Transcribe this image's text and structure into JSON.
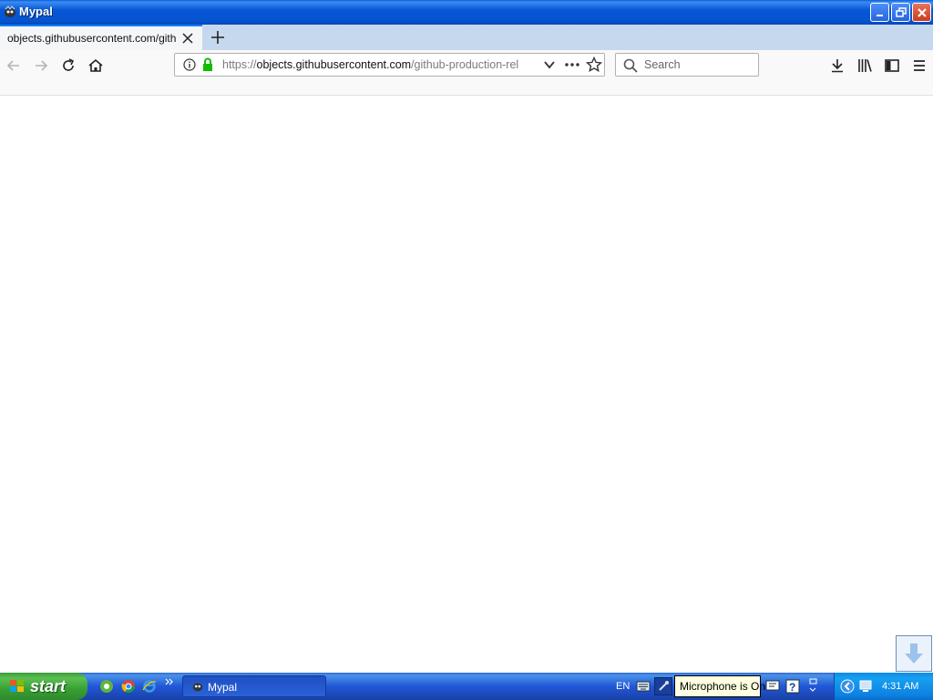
{
  "window": {
    "title": "Mypal",
    "icon": "mypal-app-icon"
  },
  "window_controls": {
    "minimize_icon": "minimize-icon",
    "restore_icon": "restore-icon",
    "close_icon": "close-icon"
  },
  "tabs": [
    {
      "label": "objects.githubusercontent.com/github",
      "active": true
    }
  ],
  "navbar": {
    "back_icon": "back-arrow-icon",
    "forward_icon": "forward-arrow-icon",
    "reload_icon": "reload-icon",
    "home_icon": "home-icon",
    "url": {
      "scheme": "https://",
      "host": "objects.githubusercontent.com",
      "path": "/github-production-rel"
    },
    "search_placeholder": "Search"
  },
  "taskbar": {
    "start_label": "start",
    "task_item_label": "Mypal",
    "language": "EN",
    "mic_tooltip": "Microphone is On",
    "clock": "4:31 AM"
  },
  "colors": {
    "accent": "#0a84ff",
    "titlebar": "#0553cf",
    "taskbar": "#2157d7",
    "start": "#37a034"
  }
}
